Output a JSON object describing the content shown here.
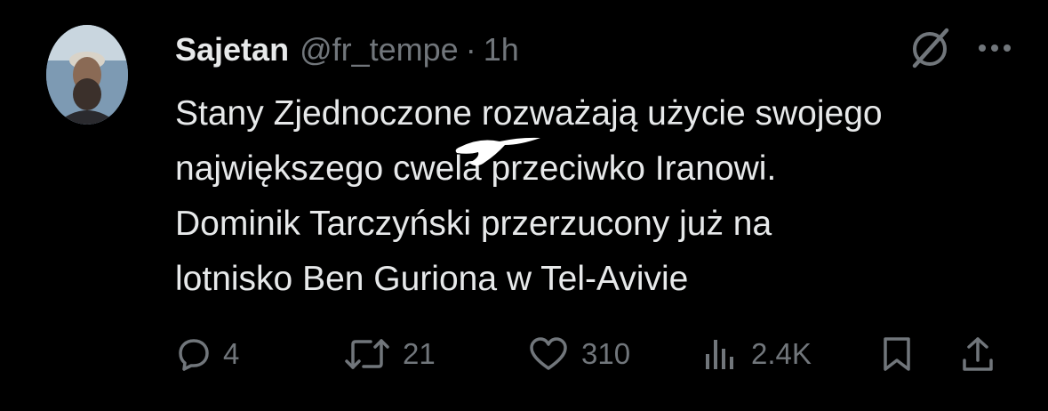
{
  "tweet": {
    "author_name": "Sajetan",
    "handle": "@fr_tempe",
    "separator": "·",
    "time": "1h",
    "text_lines": [
      "Stany Zjednoczone rozważają użycie swojego",
      "największego cwela przeciwko Iranowi.",
      "Dominik Tarczyński przerzucony już na",
      "lotnisko Ben Guriona w Tel-Avivie"
    ]
  },
  "actions": {
    "replies": "4",
    "reposts": "21",
    "likes": "310",
    "views": "2.4K"
  },
  "icons": {
    "grok": "grok-icon",
    "more": "more-icon",
    "reply": "reply-icon",
    "repost": "repost-icon",
    "like": "heart-icon",
    "views": "views-icon",
    "bookmark": "bookmark-icon",
    "share": "share-icon"
  },
  "colors": {
    "background": "#000000",
    "text": "#e7e9ea",
    "secondary": "#71767b"
  }
}
